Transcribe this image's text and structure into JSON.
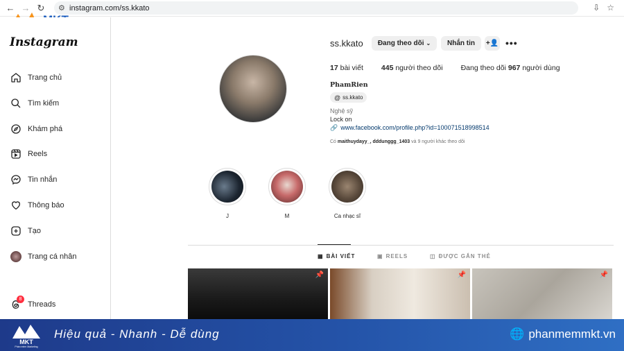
{
  "browser": {
    "url": "instagram.com/ss.kkato"
  },
  "mkt_logo": {
    "text": "MKT",
    "tagline": "Phần mềm Marketing đa kênh"
  },
  "sidebar": {
    "logo": "Instagram",
    "items": [
      {
        "label": "Trang chủ",
        "icon": "home-icon"
      },
      {
        "label": "Tìm kiếm",
        "icon": "search-icon"
      },
      {
        "label": "Khám phá",
        "icon": "compass-icon"
      },
      {
        "label": "Reels",
        "icon": "reels-icon"
      },
      {
        "label": "Tin nhắn",
        "icon": "messenger-icon"
      },
      {
        "label": "Thông báo",
        "icon": "heart-icon"
      },
      {
        "label": "Tạo",
        "icon": "plus-square-icon"
      },
      {
        "label": "Trang cá nhân",
        "icon": "avatar-icon"
      },
      {
        "label": "Threads",
        "icon": "threads-icon",
        "badge": "8"
      }
    ]
  },
  "profile": {
    "username": "ss.kkato",
    "follow_button": "Đang theo dõi",
    "message_button": "Nhắn tin",
    "posts_count": "17",
    "posts_label": "bài viết",
    "followers_count": "445",
    "followers_label": "người theo dõi",
    "following_prefix": "Đang theo dõi",
    "following_count": "967",
    "following_label": "người dùng",
    "full_name": "PhamRien",
    "threads_handle": "ss.kkato",
    "category": "Nghệ sỹ",
    "bio": "Lock on",
    "link": "www.facebook.com/profile.php?id=100071518998514",
    "followed_by_prefix": "Có",
    "followed_by_names": "maithuydayy_, dddunggg_1403",
    "followed_by_suffix": "và 9 người khác theo dõi"
  },
  "highlights": [
    {
      "label": "J"
    },
    {
      "label": "M"
    },
    {
      "label": "Ca nhạc sĩ"
    }
  ],
  "tabs": [
    {
      "label": "BÀI VIẾT",
      "icon": "grid-icon",
      "active": true
    },
    {
      "label": "REELS",
      "icon": "reels-icon"
    },
    {
      "label": "ĐƯỢC GẮN THẺ",
      "icon": "tag-icon"
    }
  ],
  "banner": {
    "logo": "MKT",
    "logo_tagline": "Phần mềm Marketing",
    "slogan": "Hiệu quả - Nhanh  - Dễ dùng",
    "website": "phanmemmkt.vn"
  },
  "colors": {
    "link": "#00376b",
    "badge": "#ff3040",
    "banner": "#2453a8",
    "mkt_orange": "#f7941d"
  }
}
